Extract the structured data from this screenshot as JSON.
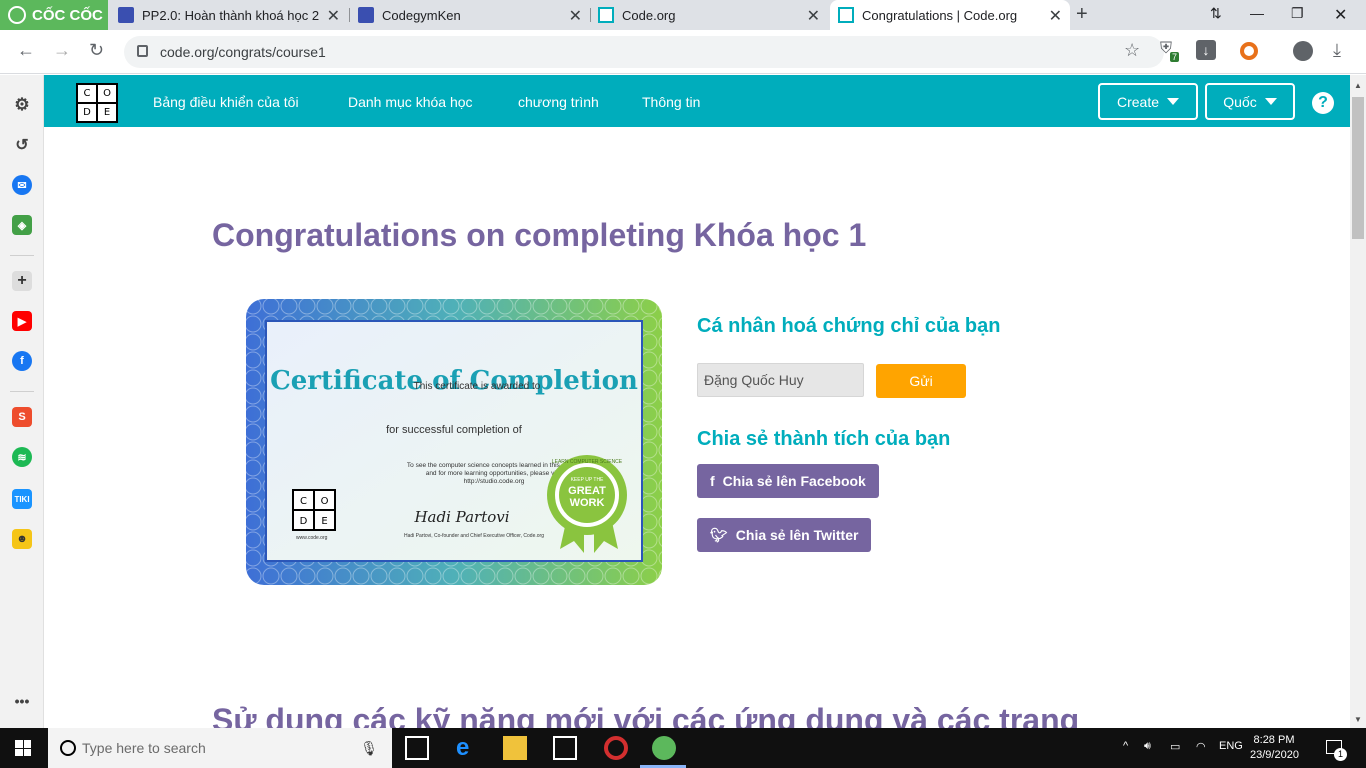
{
  "browser": {
    "brand": "CỐC CỐC",
    "tabs": [
      {
        "title": "PP2.0: Hoàn thành khoá học 2"
      },
      {
        "title": "CodegymKen"
      },
      {
        "title": "Code.org"
      },
      {
        "title": "Congratulations | Code.org"
      }
    ],
    "url": "code.org/congrats/course1",
    "extension_badge": "7"
  },
  "site": {
    "logo_letters": [
      "C",
      "O",
      "D",
      "E"
    ],
    "nav": [
      "Bảng điều khiển của tôi",
      "Danh mục khóa học",
      "chương trình",
      "Thông tin"
    ],
    "create_label": "Create",
    "country_label": "Quốc",
    "help": "?",
    "accent": "#00adbc",
    "purple": "#7665a0",
    "orange": "#ffa400"
  },
  "page": {
    "headline": "Congratulations on completing Khóa học 1",
    "personalize_title": "Cá nhân hoá chứng chỉ của bạn",
    "name_value": "Đặng Quốc Huy",
    "submit_label": "Gửi",
    "share_title": "Chia sẻ thành tích của bạn",
    "facebook_label": "Chia sẻ lên Facebook",
    "twitter_label": "Chia sẻ lên Twitter",
    "more_heading": "Sử dụng các kỹ năng mới với các ứng dụng và các trang"
  },
  "certificate": {
    "title": "Certificate of Completion",
    "awarded": "This certificate is awarded to",
    "completion": "for successful completion of",
    "desc1": "To see the computer science concepts learned in this course",
    "desc2": "and for more learning opportunities, please visit",
    "desc3": "http://studio.code.org",
    "signature": "Hadi Partovi",
    "signer": "Hadi Partovi, Co-founder and Chief Executive Officer, Code.org",
    "site": "www.code.org",
    "badge_top": "KEEP UP THE",
    "badge_main1": "GREAT",
    "badge_main2": "WORK",
    "badge_ring": "LEARN COMPUTER SCIENCE"
  },
  "taskbar": {
    "search_placeholder": "Type here to search",
    "language": "ENG",
    "time": "8:28 PM",
    "date": "23/9/2020",
    "notifications": "1"
  }
}
